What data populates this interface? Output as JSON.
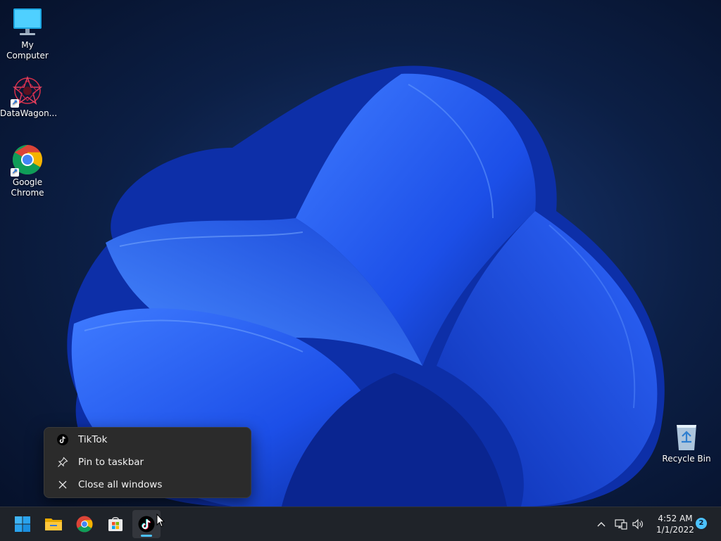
{
  "desktop": {
    "icons": [
      {
        "label": "My Computer",
        "icon": "monitor-icon"
      },
      {
        "label": "DataWagon...",
        "icon": "datawagon-logo-icon"
      },
      {
        "label": "Google\nChrome",
        "icon": "chrome-icon"
      },
      {
        "label": "Recycle Bin",
        "icon": "recycle-bin-icon"
      }
    ]
  },
  "context_menu": {
    "items": [
      {
        "label": "TikTok",
        "icon": "tiktok-icon"
      },
      {
        "label": "Pin to taskbar",
        "icon": "pin-icon"
      },
      {
        "label": "Close all windows",
        "icon": "close-icon"
      }
    ]
  },
  "taskbar": {
    "apps": [
      {
        "name": "Start",
        "icon": "windows-start-icon"
      },
      {
        "name": "File Explorer",
        "icon": "folder-icon"
      },
      {
        "name": "Google Chrome",
        "icon": "chrome-icon"
      },
      {
        "name": "Microsoft Store",
        "icon": "store-icon"
      },
      {
        "name": "TikTok",
        "icon": "tiktok-icon",
        "active": true
      }
    ],
    "tray": {
      "time": "4:52 AM",
      "date": "1/1/2022",
      "notification_count": "2"
    }
  },
  "colors": {
    "wallpaper_bg": "#0a1a38",
    "bloom_blue": "#1f5cff",
    "taskbar_bg": "#1f2329",
    "menu_bg": "#2b2b2b",
    "accent": "#4cc2ff"
  }
}
